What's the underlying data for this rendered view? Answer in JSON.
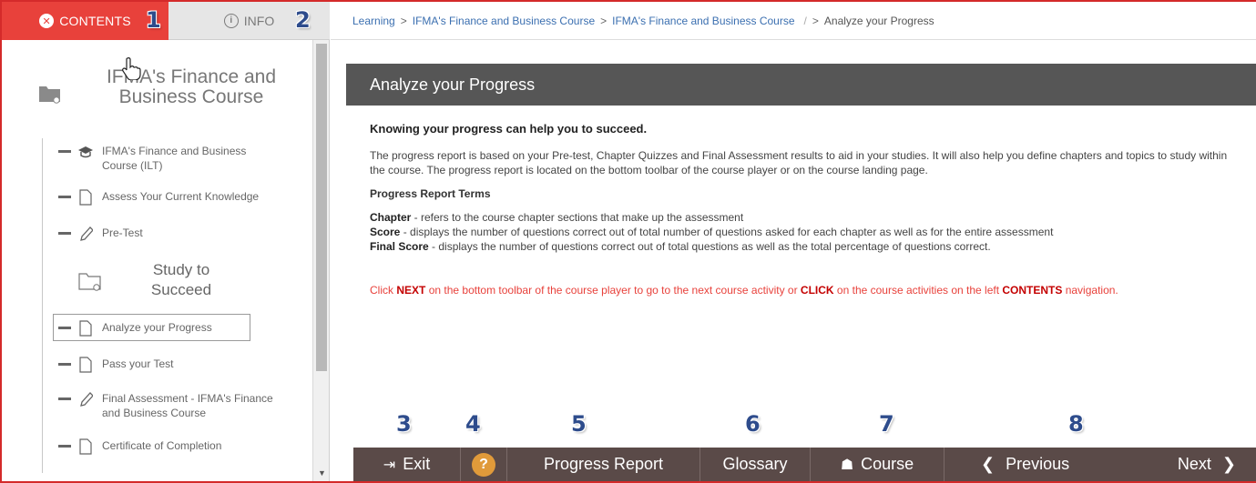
{
  "tabs": {
    "contents_label": "CONTENTS",
    "info_label": "INFO"
  },
  "callouts": [
    "1",
    "2",
    "3",
    "4",
    "5",
    "6",
    "7",
    "8"
  ],
  "course": {
    "title": "IFMA's Finance and Business Course"
  },
  "tree": {
    "items": [
      {
        "label": "IFMA's Finance and Business Course (ILT)",
        "icon": "graduation-cap-icon"
      },
      {
        "label": "Assess Your Current Knowledge",
        "icon": "page-icon"
      },
      {
        "label": "Pre-Test",
        "icon": "pencil-icon"
      },
      {
        "label": "Analyze your Progress",
        "icon": "page-icon"
      },
      {
        "label": "Pass your Test",
        "icon": "page-icon"
      },
      {
        "label": "Final Assessment - IFMA's Finance and Business Course",
        "icon": "pencil-icon"
      },
      {
        "label": "Certificate of Completion",
        "icon": "page-icon"
      }
    ],
    "section_title": "Study to Succeed"
  },
  "breadcrumb": {
    "items": [
      "Learning",
      "IFMA's Finance and Business Course",
      "IFMA's Finance and Business Course",
      "Analyze your Progress"
    ],
    "sep": ">",
    "slash": "/"
  },
  "page": {
    "title": "Analyze your Progress",
    "lead": "Knowing your progress can help you to succeed.",
    "intro": "The progress report is based on your Pre-test, Chapter Quizzes and Final Assessment results to aid in your studies. It will also help you define chapters and topics to study within the course. The progress report is located on the bottom toolbar of the course player or on the course landing page.",
    "terms_title": "Progress Report Terms",
    "terms": [
      {
        "term": "Chapter",
        "desc": " - refers to the course chapter sections that make up the assessment"
      },
      {
        "term": "Score",
        "desc": " - displays the number of questions correct out of total number of questions asked for each chapter as well as for the entire assessment"
      },
      {
        "term": "Final Score",
        "desc": " - displays the number of questions correct out of total questions as well as the total percentage of questions correct."
      }
    ],
    "note_part1": "Click ",
    "note_next": "NEXT",
    "note_part2": " on the bottom toolbar of the course player to go to the next course activity or ",
    "note_click": "CLICK",
    "note_part3": " on the course activities on the left ",
    "note_contents": "CONTENTS",
    "note_part4": " navigation."
  },
  "toolbar": {
    "exit": "Exit",
    "help": "?",
    "progress_report": "Progress Report",
    "glossary": "Glossary",
    "course": "Course",
    "previous": "Previous",
    "next": "Next"
  },
  "colors": {
    "accent": "#e8413b",
    "toolbar_bg": "#5a4a48",
    "header_bg": "#565656",
    "help_orange": "#e09a3a",
    "callout_blue": "#2e4c8c"
  }
}
